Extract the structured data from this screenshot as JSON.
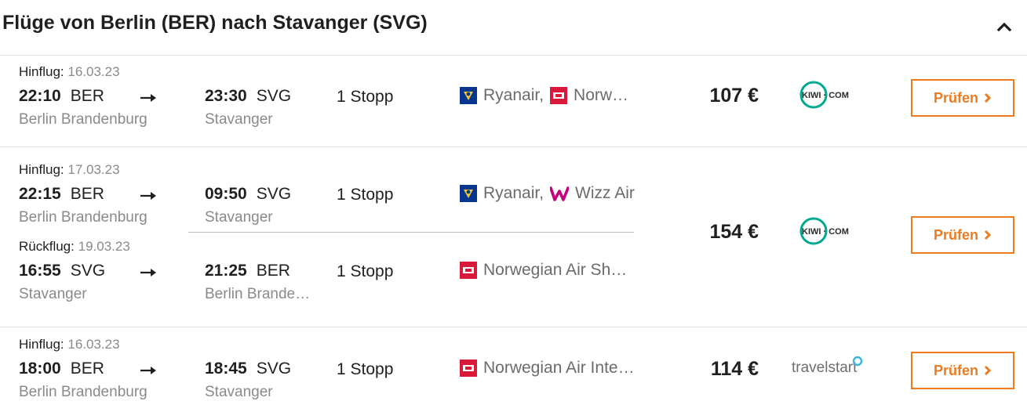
{
  "header": {
    "title": "Flüge von Berlin (BER) nach Stavanger (SVG)"
  },
  "results": [
    {
      "legs": [
        {
          "label": "Hinflug:",
          "date": "16.03.23",
          "dep_time": "22:10",
          "dep_code": "BER",
          "dep_city": "Berlin Brandenburg",
          "arr_time": "23:30",
          "arr_code": "SVG",
          "arr_city": "Stavanger",
          "stops": "1 Stopp",
          "airlines": [
            {
              "logo": "ryanair-logo",
              "name": "Ryanair,"
            },
            {
              "logo": "norwegian-logo",
              "name": "Norw…"
            }
          ]
        }
      ],
      "price": "107 €",
      "provider": "KIWI · COM",
      "button": "Prüfen"
    },
    {
      "legs": [
        {
          "label": "Hinflug:",
          "date": "17.03.23",
          "dep_time": "22:15",
          "dep_code": "BER",
          "dep_city": "Berlin Brandenburg",
          "arr_time": "09:50",
          "arr_code": "SVG",
          "arr_city": "Stavanger",
          "stops": "1 Stopp",
          "airlines": [
            {
              "logo": "ryanair-logo",
              "name": "Ryanair,"
            },
            {
              "logo": "wizz-air-logo",
              "name": "Wizz Air"
            }
          ]
        },
        {
          "label": "Rückflug:",
          "date": "19.03.23",
          "dep_time": "16:55",
          "dep_code": "SVG",
          "dep_city": "Stavanger",
          "arr_time": "21:25",
          "arr_code": "BER",
          "arr_city": "Berlin Brande…",
          "stops": "1 Stopp",
          "airlines": [
            {
              "logo": "norwegian-logo",
              "name": "Norwegian Air Sh…"
            }
          ]
        }
      ],
      "price": "154 €",
      "provider": "KIWI · COM",
      "button": "Prüfen"
    },
    {
      "legs": [
        {
          "label": "Hinflug:",
          "date": "16.03.23",
          "dep_time": "18:00",
          "dep_code": "BER",
          "dep_city": "Berlin Brandenburg",
          "arr_time": "18:45",
          "arr_code": "SVG",
          "arr_city": "Stavanger",
          "stops": "1 Stopp",
          "airlines": [
            {
              "logo": "norwegian-logo",
              "name": "Norwegian Air Inte…"
            }
          ]
        }
      ],
      "price": "114 €",
      "provider": "travelstart",
      "button": "Prüfen"
    }
  ],
  "colors": {
    "accent": "#ee7b1e",
    "muted_text": "#8a8a8a",
    "kiwi_teal": "#00a991",
    "ryanair_blue": "#073590",
    "norwegian_red": "#d81939",
    "wizz_purple": "#c6007e"
  }
}
